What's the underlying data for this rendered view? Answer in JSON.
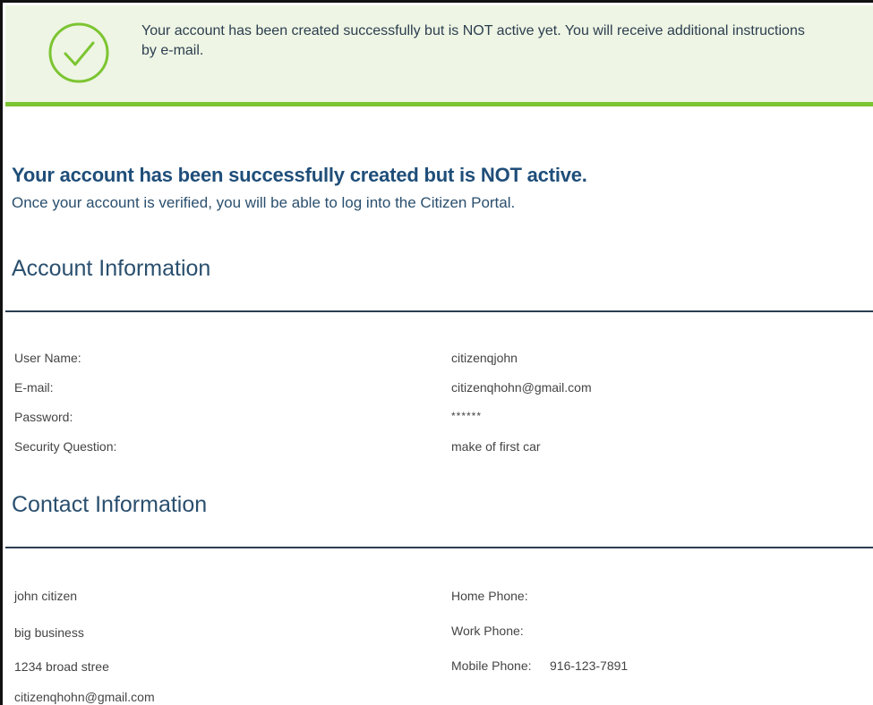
{
  "banner": {
    "message": "Your account has been created successfully but is NOT active yet. You will receive additional instructions by e-mail.",
    "icon": "check-circle-icon",
    "background_color": "#eef5e4",
    "accent_color": "#7cc532"
  },
  "page": {
    "title": "Your account has been successfully created but is NOT active.",
    "subtitle": "Once your account is verified, you will be able to log into the Citizen Portal."
  },
  "account": {
    "heading": "Account Information",
    "fields": [
      {
        "label": "User Name:",
        "value": "citizenqjohn"
      },
      {
        "label": "E-mail:",
        "value": "citizenqhohn@gmail.com"
      },
      {
        "label": "Password:",
        "value": "******"
      },
      {
        "label": "Security Question:",
        "value": "make of first car"
      }
    ]
  },
  "contact": {
    "heading": "Contact Information",
    "left": [
      "john citizen",
      "big business",
      "1234 broad stree",
      "citizenqhohn@gmail.com"
    ],
    "phones": [
      {
        "label": "Home Phone:",
        "value": ""
      },
      {
        "label": "Work Phone:",
        "value": ""
      },
      {
        "label": "Mobile Phone:",
        "value": "916-123-7891"
      }
    ]
  },
  "colors": {
    "title": "#1f4e79",
    "heading": "#2a4f6e",
    "rule": "#2b3d52",
    "field_text": "#444444"
  }
}
